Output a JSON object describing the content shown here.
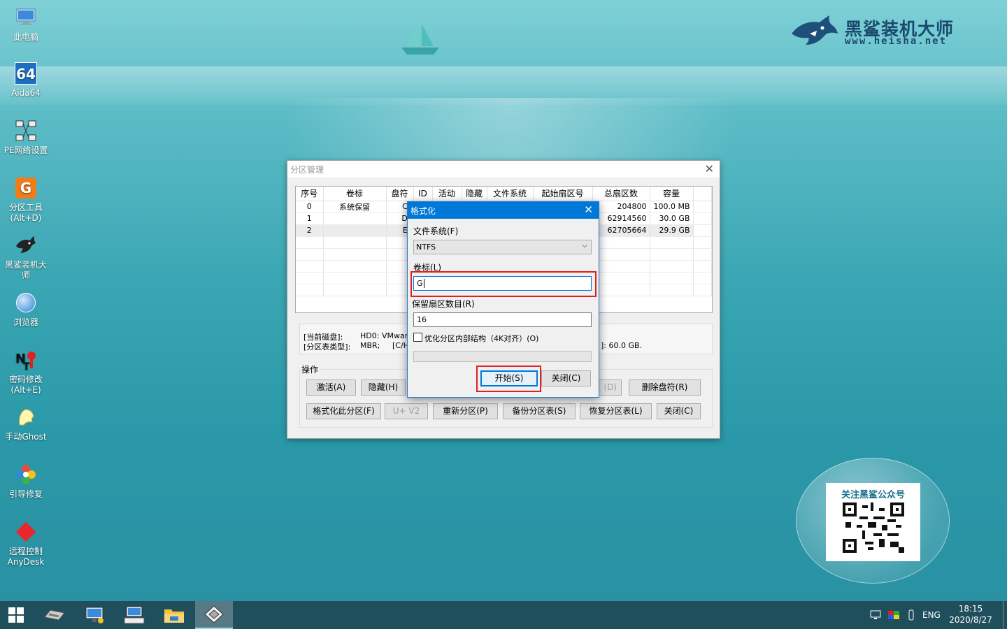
{
  "desktop_icons": [
    {
      "label": "此电脑",
      "label2": "",
      "icon": "computer-icon"
    },
    {
      "label": "Aida64",
      "label2": "",
      "icon": "aida64-icon"
    },
    {
      "label": "PE网络设置",
      "label2": "",
      "icon": "network-icon"
    },
    {
      "label": "分区工具",
      "label2": "(Alt+D)",
      "icon": "partition-tool-icon"
    },
    {
      "label": "黑鲨装机大",
      "label2": "师",
      "icon": "shark-icon"
    },
    {
      "label": "浏览器",
      "label2": "",
      "icon": "browser-icon"
    },
    {
      "label": "密码修改",
      "label2": "(Alt+E)",
      "icon": "password-icon"
    },
    {
      "label": "手动Ghost",
      "label2": "",
      "icon": "ghost-icon"
    },
    {
      "label": "引导修复",
      "label2": "",
      "icon": "boot-repair-icon"
    },
    {
      "label": "远程控制",
      "label2": "AnyDesk",
      "icon": "anydesk-icon"
    }
  ],
  "brand": {
    "title": "黑鲨装机大师",
    "url": "www.heisha.net"
  },
  "qr": {
    "title": "关注黑鲨公众号"
  },
  "partition_window": {
    "title": "分区管理",
    "columns": [
      "序号",
      "卷标",
      "盘符",
      "ID",
      "活动",
      "隐藏",
      "文件系统",
      "起始扇区号",
      "总扇区数",
      "容量"
    ],
    "rows": [
      {
        "no": "0",
        "label": "系统保留",
        "drive": "C:",
        "total": "204800",
        "size": "100.0 MB"
      },
      {
        "no": "1",
        "label": "",
        "drive": "D:",
        "total": "62914560",
        "size": "30.0 GB"
      },
      {
        "no": "2",
        "label": "",
        "drive": "E:",
        "total": "62705664",
        "size": "29.9 GB"
      }
    ],
    "info": {
      "disk_label": "[当前磁盘]:",
      "disk_value": "HD0: VMware,",
      "table_label": "[分区表类型]:",
      "table_value": "MBR;",
      "table_extra": "[C/H",
      "capacity_tail": "]: 60.0 GB."
    },
    "ops_label": "操作",
    "buttons": {
      "activate": "激活(A)",
      "hide": "隐藏(H)",
      "partial_d": "(D)",
      "delete_letter": "删除盘符(R)",
      "format": "格式化此分区(F)",
      "uv2": "U+ V2",
      "repartition": "重新分区(P)",
      "backup": "备份分区表(S)",
      "restore": "恢复分区表(L)",
      "close": "关闭(C)"
    }
  },
  "format_dialog": {
    "title": "格式化",
    "fs_label": "文件系统(F)",
    "fs_value": "NTFS",
    "volume_label": "卷标(L)",
    "volume_value": "G",
    "reserved_label": "保留扇区数目(R)",
    "reserved_value": "16",
    "optimize_label": "优化分区内部结构（4K对齐）(O)",
    "optimize_checked": false,
    "start_button": "开始(S)",
    "close_button": "关闭(C)"
  },
  "taskbar": {
    "lang": "ENG",
    "time": "18:15",
    "date": "2020/8/27"
  }
}
